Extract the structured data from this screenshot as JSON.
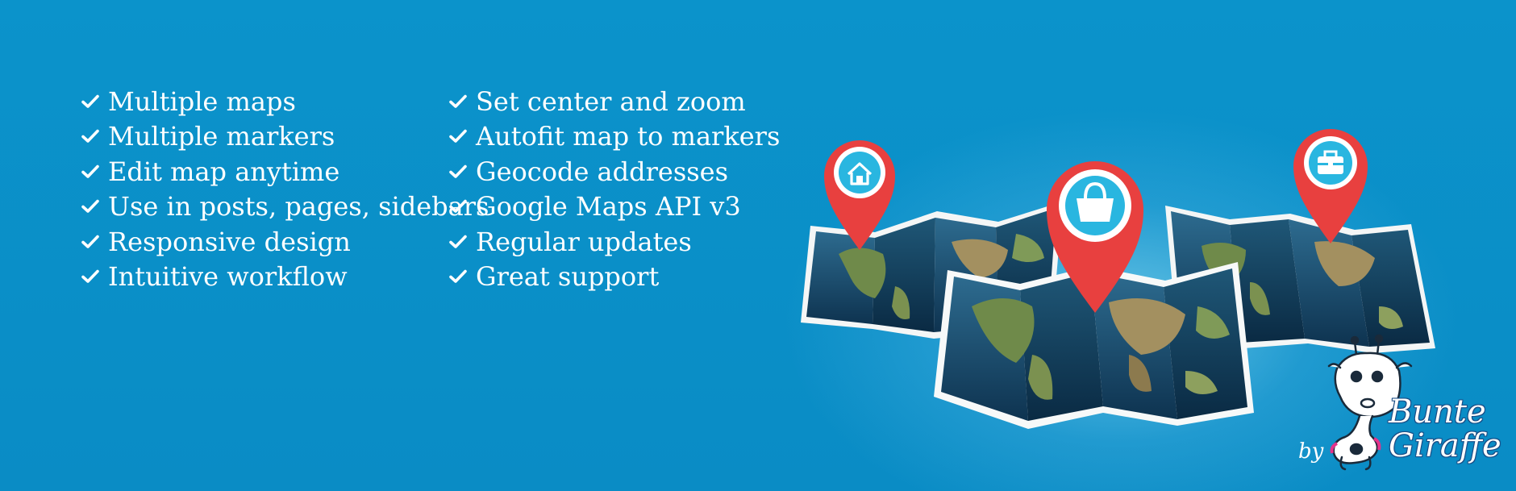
{
  "features_left": [
    "Multiple maps",
    "Multiple markers",
    "Edit map anytime",
    "Use in posts, pages, sidebars",
    "Responsive design",
    "Intuitive workflow"
  ],
  "features_right": [
    "Set center and zoom",
    "Autofit map to markers",
    "Geocode addresses",
    "Google Maps API v3",
    "Regular updates",
    "Great support"
  ],
  "branding": {
    "by": "by",
    "name_line1": "Bunte",
    "name_line2": "Giraffe"
  },
  "icons": {
    "check": "check-icon",
    "marker_left": "home-icon",
    "marker_center": "shopping-bag-icon",
    "marker_right": "briefcase-icon"
  },
  "colors": {
    "background": "#0a8fc7",
    "marker": "#e8403f",
    "icon_circle": "#29b6e0",
    "text": "#ffffff"
  }
}
